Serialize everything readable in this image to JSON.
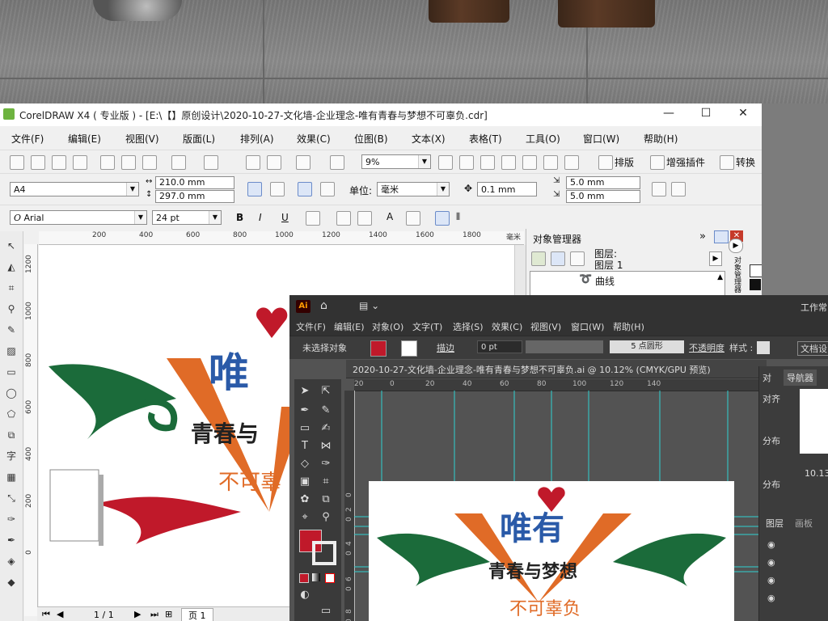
{
  "corel": {
    "title": "CorelDRAW X4 ( 专业版 ) - [E:\\【】原创设计\\2020-10-27-文化墙-企业理念-唯有青春与梦想不可辜负.cdr]",
    "window_controls": [
      "—",
      "☐",
      "✕"
    ],
    "menu": [
      "文件(F)",
      "编辑(E)",
      "视图(V)",
      "版面(L)",
      "排列(A)",
      "效果(C)",
      "位图(B)",
      "文本(X)",
      "表格(T)",
      "工具(O)",
      "窗口(W)",
      "帮助(H)"
    ],
    "zoom": "9%",
    "toolbar_labels": {
      "layout": "排版",
      "plugin": "增强插件",
      "convert": "转换"
    },
    "page_size": "A4",
    "width": "210.0 mm",
    "height": "297.0 mm",
    "units_label": "单位:",
    "units": "毫米",
    "nudge": "0.1 mm",
    "dup_x": "5.0 mm",
    "dup_y": "5.0 mm",
    "font": "Arial",
    "font_size": "24 pt",
    "ruler_h": [
      "200",
      "400",
      "600",
      "800",
      "1000",
      "1200",
      "1400",
      "1600",
      "1800",
      "毫米"
    ],
    "ruler_v": [
      "1200",
      "1000",
      "800",
      "600",
      "400",
      "200",
      "0"
    ],
    "docker": {
      "title": "对象管理器",
      "layer_label": "图层:",
      "layer_name": "图层 1",
      "item": "曲线",
      "side_tab": "对象管理器"
    },
    "status": {
      "page_count": "1 / 1",
      "page_tab": "页 1"
    },
    "artwork": {
      "top": "唯",
      "middle": "青春与",
      "bottom": "不可辜"
    }
  },
  "ai": {
    "app_badge": "Ai",
    "workspace": "工作常",
    "menu": [
      "文件(F)",
      "编辑(E)",
      "对象(O)",
      "文字(T)",
      "选择(S)",
      "效果(C)",
      "视图(V)",
      "窗口(W)",
      "帮助(H)"
    ],
    "ctrl": {
      "no_selection": "未选择对象",
      "stroke_label": "描边",
      "stroke_value": "0 pt",
      "brush": "5 点圆形",
      "opacity": "不透明度",
      "style": "样式 :",
      "doc_setup": "文档设"
    },
    "tab_title": "2020-10-27-文化墙-企业理念-唯有青春与梦想不可辜负.ai @ 10.12% (CMYK/GPU 预览)",
    "ruler_h": [
      "20",
      "0",
      "20",
      "40",
      "60",
      "80",
      "100",
      "120",
      "140"
    ],
    "ruler_v": [
      "0",
      "2",
      "0",
      "4",
      "0",
      "6",
      "0",
      "8",
      "0"
    ],
    "panels": {
      "align": "对",
      "navigator": "导航器",
      "align_objects": "对齐",
      "distribute": "分布",
      "distribute2": "分布",
      "zoom": "10.13",
      "layers": "图层",
      "artboards": "画板"
    },
    "artwork": {
      "top": "唯有",
      "middle": "青春与梦想",
      "bottom": "不可辜负"
    }
  },
  "colors": {
    "fill": "#c0192a",
    "red": "#c0192a",
    "blue": "#2a5aa8",
    "green": "#1b6b3a",
    "orange": "#e06b27"
  }
}
